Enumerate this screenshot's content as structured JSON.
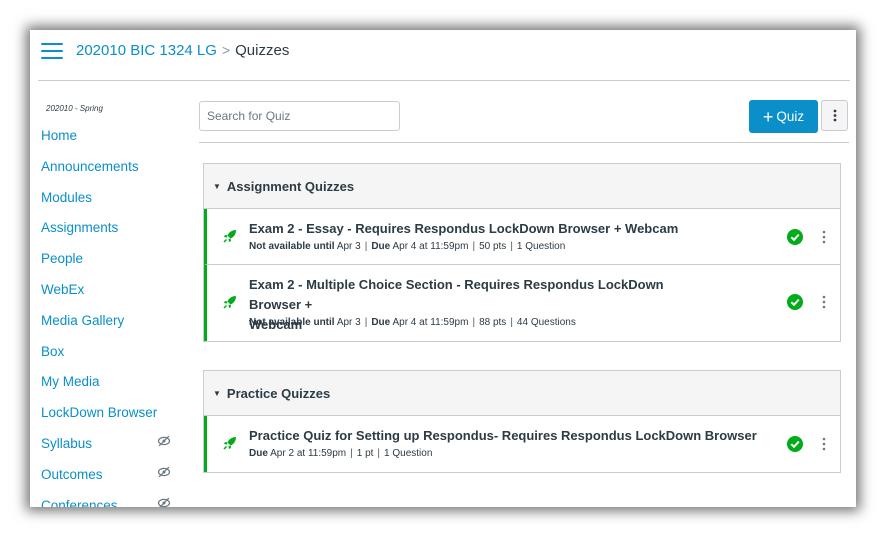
{
  "header": {
    "course": "202010 BIC 1324 LG",
    "separator": ">",
    "current": "Quizzes"
  },
  "sidebar": {
    "term": "202010 - Spring",
    "items": [
      {
        "label": "Home",
        "hidden": false
      },
      {
        "label": "Announcements",
        "hidden": false
      },
      {
        "label": "Modules",
        "hidden": false
      },
      {
        "label": "Assignments",
        "hidden": false
      },
      {
        "label": "People",
        "hidden": false
      },
      {
        "label": "WebEx",
        "hidden": false
      },
      {
        "label": "Media Gallery",
        "hidden": false
      },
      {
        "label": "Box",
        "hidden": false
      },
      {
        "label": "My Media",
        "hidden": false
      },
      {
        "label": "LockDown Browser",
        "hidden": false
      },
      {
        "label": "Syllabus",
        "hidden": true
      },
      {
        "label": "Outcomes",
        "hidden": true
      },
      {
        "label": "Conferences",
        "hidden": true
      }
    ]
  },
  "toolbar": {
    "search_placeholder": "Search for Quiz",
    "add_plus": "+",
    "add_label": "Quiz"
  },
  "groups": [
    {
      "title": "Assignment Quizzes",
      "quizzes": [
        {
          "title_line1": "Exam 2 - Essay - Requires Respondus LockDown Browser + Webcam",
          "title_line2": "",
          "availability_label": "Not available until",
          "availability_date": "Apr 3",
          "due_label": "Due",
          "due_date": "Apr 4 at 11:59pm",
          "points": "50 pts",
          "questions": "1 Question",
          "published": true
        },
        {
          "title_line1": "Exam 2 - Multiple Choice Section - Requires Respondus LockDown Browser +",
          "title_line2": "Webcam",
          "availability_label": "Not available until",
          "availability_date": "Apr 3",
          "due_label": "Due",
          "due_date": "Apr 4 at 11:59pm",
          "points": "88 pts",
          "questions": "44 Questions",
          "published": true
        }
      ]
    },
    {
      "title": "Practice Quizzes",
      "quizzes": [
        {
          "title_line1": "Practice Quiz for Setting up Respondus- Requires Respondus LockDown Browser",
          "title_line2": "",
          "availability_label": "",
          "availability_date": "",
          "due_label": "Due",
          "due_date": "Apr 2 at 11:59pm",
          "points": "1 pt",
          "questions": "1 Question",
          "published": true
        }
      ]
    }
  ],
  "colors": {
    "link": "#0a8fc8",
    "published": "#00ac18",
    "text": "#2d3b45",
    "border": "#c7cdd1",
    "header_bg": "#f5f5f5"
  },
  "icons": {
    "menu": "hamburger-icon",
    "quiz": "rocket-icon",
    "published": "check-circle-icon",
    "options": "kebab-icon",
    "hidden": "eye-slash-icon",
    "collapse": "caret-down-icon"
  }
}
